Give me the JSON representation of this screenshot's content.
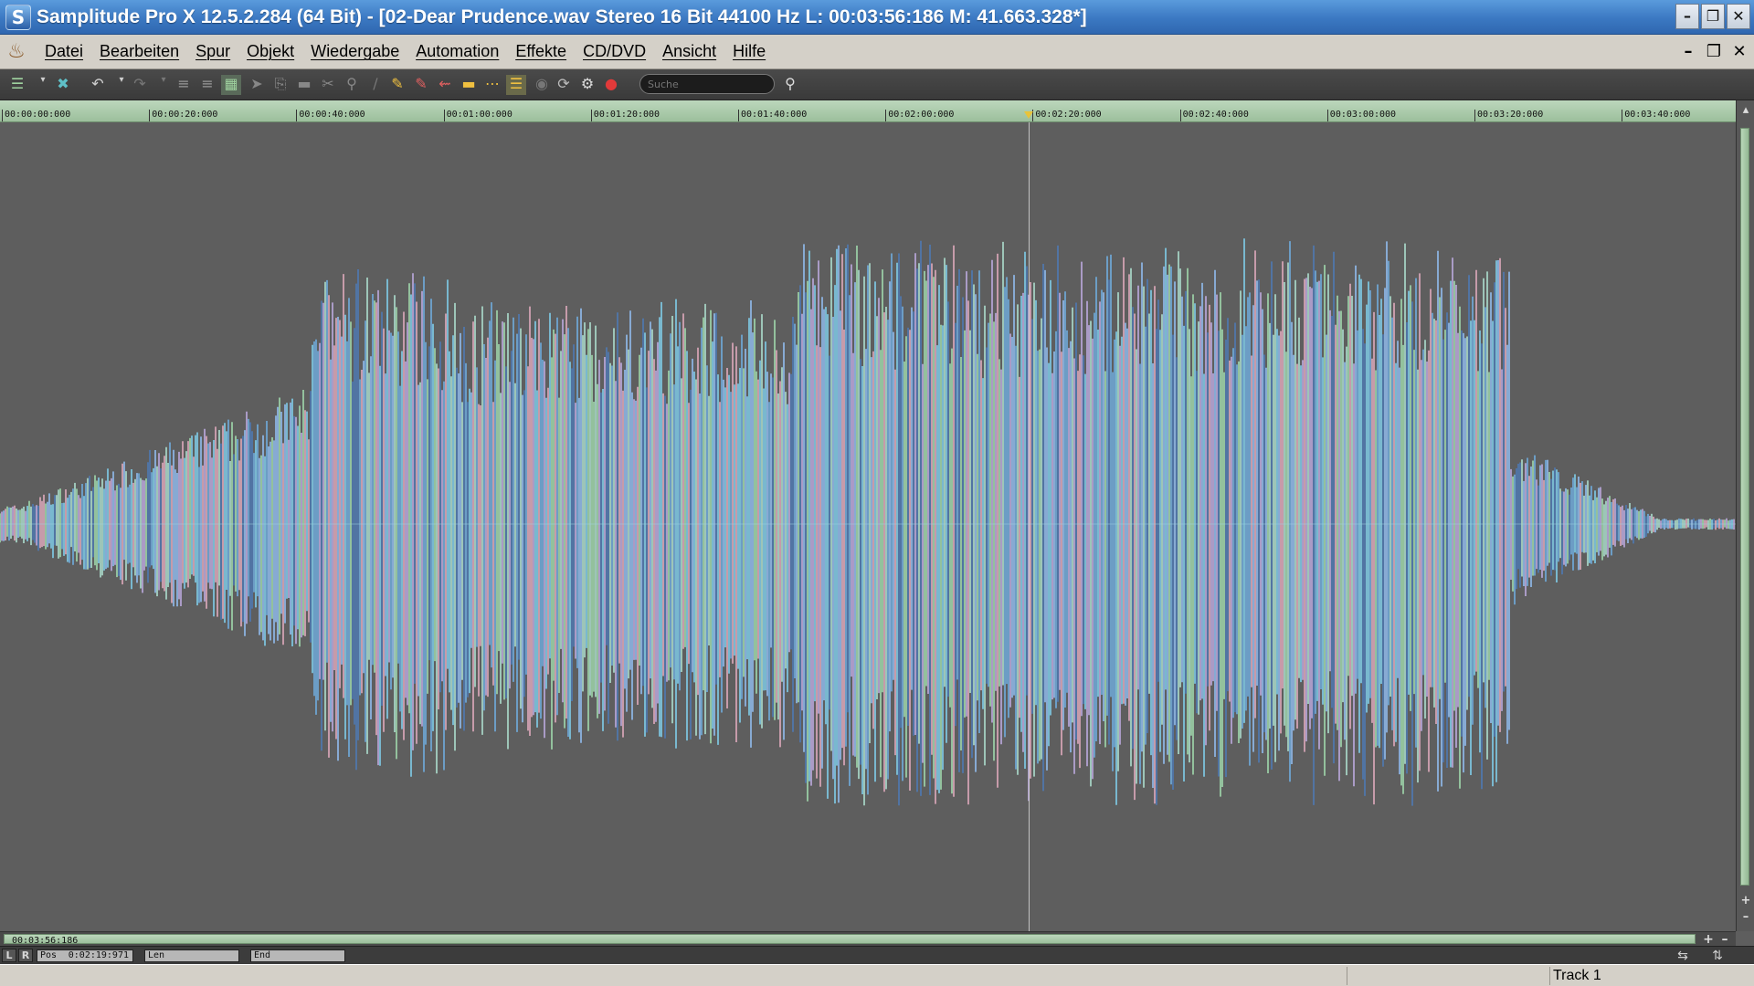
{
  "window": {
    "icon_letter": "S",
    "title": "Samplitude Pro X 12.5.2.284 (64 Bit) - [02-Dear Prudence.wav  Stereo 16 Bit 44100 Hz L: 00:03:56:186 M: 41.663.328*]"
  },
  "menu": {
    "items": [
      "Datei",
      "Bearbeiten",
      "Spur",
      "Objekt",
      "Wiedergabe",
      "Automation",
      "Effekte",
      "CD/DVD",
      "Ansicht",
      "Hilfe"
    ]
  },
  "toolbar": {
    "search_placeholder": "Suche"
  },
  "ruler": {
    "ticks": [
      "00:00:00:000",
      "00:00:20:000",
      "00:00:40:000",
      "00:01:00:000",
      "00:01:20:000",
      "00:01:40:000",
      "00:02:00:000",
      "00:02:20:000",
      "00:02:40:000",
      "00:03:00:000",
      "00:03:20:000",
      "00:03:40:000"
    ]
  },
  "scroll": {
    "length_label": "00:03:56:186"
  },
  "position_bar": {
    "left_btn": "L",
    "right_btn": "R",
    "pos_label": "Pos",
    "pos_value": "0:02:19:971",
    "len_label": "Len",
    "end_label": "End"
  },
  "status": {
    "track": "Track 1"
  },
  "waveform": {
    "cursor_time": "00:02:19:971",
    "total_seconds": 236.186,
    "colors": [
      "#6fa8d8",
      "#7ec8e3",
      "#9dd3a8",
      "#4f78b0",
      "#b8a6d9",
      "#d9a6b8",
      "#8fb8e8",
      "#a8d8c8"
    ]
  }
}
